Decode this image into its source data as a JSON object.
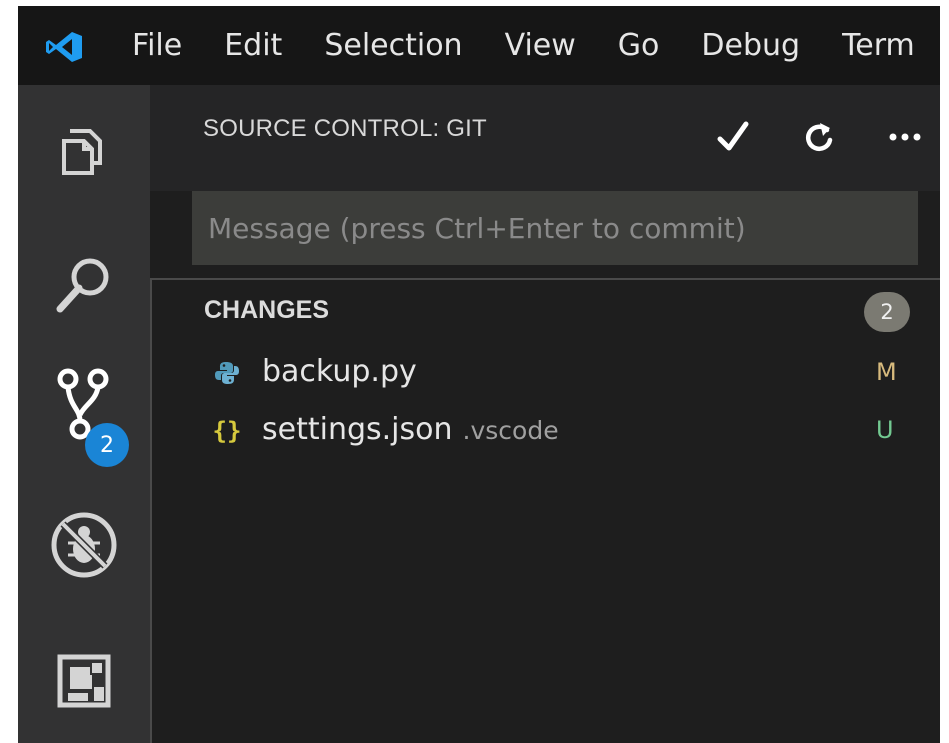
{
  "menu": {
    "logo_icon": "vscode-logo-icon",
    "items": [
      "File",
      "Edit",
      "Selection",
      "View",
      "Go",
      "Debug",
      "Term"
    ]
  },
  "activity_bar": {
    "items": [
      {
        "icon": "explorer-files-icon"
      },
      {
        "icon": "search-icon"
      },
      {
        "icon": "source-control-icon",
        "badge": "2"
      },
      {
        "icon": "debug-disabled-icon"
      },
      {
        "icon": "extensions-icon"
      }
    ]
  },
  "source_control": {
    "title": "SOURCE CONTROL: GIT",
    "actions": [
      {
        "icon": "commit-checkmark-icon",
        "glyph": "✓"
      },
      {
        "icon": "refresh-icon",
        "glyph": "↻"
      },
      {
        "icon": "more-actions-icon",
        "glyph": "•••"
      }
    ],
    "message_placeholder": "Message (press Ctrl+Enter to commit)",
    "message_value": "",
    "changes": {
      "label": "CHANGES",
      "count": "2",
      "files": [
        {
          "icon": "python-file-icon",
          "name": "backup.py",
          "dir": "",
          "status": "M",
          "status_color": "#d7ba7d"
        },
        {
          "icon": "json-file-icon",
          "name": "settings.json",
          "dir": ".vscode",
          "status": "U",
          "status_color": "#73c991"
        }
      ]
    }
  },
  "colors": {
    "accent_blue": "#1a85d6",
    "modified": "#d7ba7d",
    "untracked": "#73c991",
    "json_braces": "#d6c93d",
    "python_blue": "#519aba"
  }
}
